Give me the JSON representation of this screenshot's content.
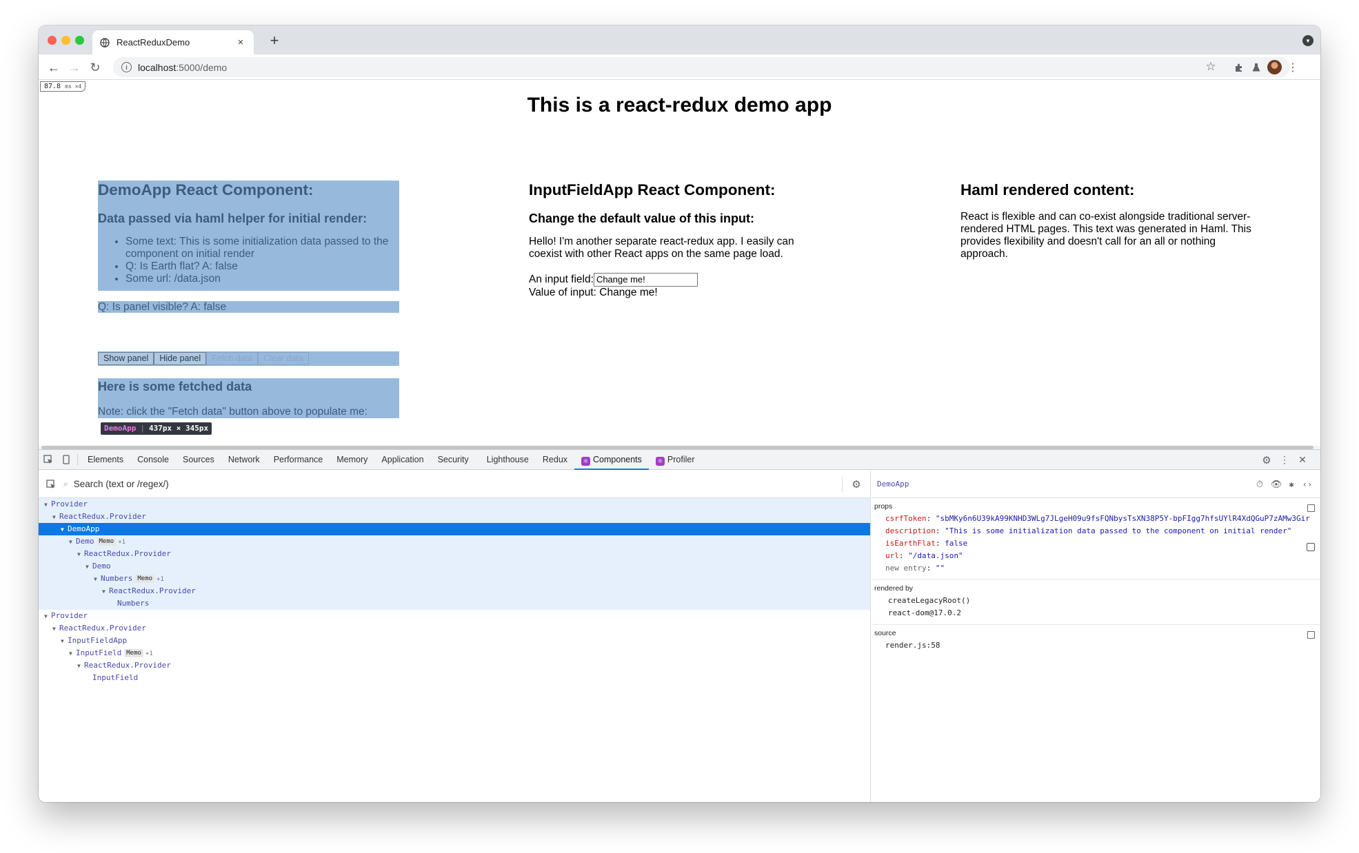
{
  "browser": {
    "tab_title": "ReactReduxDemo",
    "tab_close": "×",
    "new_tab": "+",
    "url_host": "localhost",
    "url_path": ":5000/demo"
  },
  "page": {
    "perf_value": "87.8",
    "perf_unit": "ms ×4",
    "title": "This is a react-redux demo app",
    "demo": {
      "heading": "DemoApp React Component:",
      "subheading": "Data passed via haml helper for initial render:",
      "items": [
        "Some text: This is some initialization data passed to the component on initial render",
        "Q: Is Earth flat? A: false",
        "Some url: /data.json"
      ],
      "panel_text": "Q: Is panel visible? A: false",
      "buttons": {
        "show": "Show panel",
        "hide": "Hide panel",
        "fetch": "Fetch data",
        "clear": "Clear data"
      },
      "fetched_heading": "Here is some fetched data",
      "fetched_note": "Note: click the \"Fetch data\" button above to populate me:",
      "badge_name": "DemoApp",
      "badge_size": "437px × 345px"
    },
    "input_app": {
      "heading": "InputFieldApp React Component:",
      "subheading": "Change the default value of this input:",
      "para": "Hello! I'm another separate react-redux app. I easily can coexist with other React apps on the same page load.",
      "field_label": "An input field:",
      "field_value": "Change me!",
      "value_label": "Value of input: Change me!"
    },
    "haml": {
      "heading": "Haml rendered content:",
      "para": "React is flexible and can co-exist alongside traditional server-rendered HTML pages. This text was generated in Haml. This provides flexibility and doesn't call for an all or nothing approach."
    }
  },
  "devtools": {
    "tabs": [
      "Elements",
      "Console",
      "Sources",
      "Network",
      "Performance",
      "Memory",
      "Application",
      "Security",
      "Lighthouse",
      "Redux",
      "Components",
      "Profiler"
    ],
    "active_tab": "Components",
    "search_placeholder": "Search (text or /regex/)",
    "tree": [
      {
        "label": "Provider",
        "depth": 0,
        "caret": true,
        "style": "blue"
      },
      {
        "label": "ReactRedux.Provider",
        "depth": 1,
        "caret": true,
        "style": "blue"
      },
      {
        "label": "DemoApp",
        "depth": 2,
        "caret": true,
        "style": "sel"
      },
      {
        "label": "Demo",
        "depth": 3,
        "caret": true,
        "memo": "Memo",
        "plus": "+1",
        "style": "blue"
      },
      {
        "label": "ReactRedux.Provider",
        "depth": 4,
        "caret": true,
        "style": "blue"
      },
      {
        "label": "Demo",
        "depth": 5,
        "caret": true,
        "style": "blue"
      },
      {
        "label": "Numbers",
        "depth": 6,
        "caret": true,
        "memo": "Memo",
        "plus": "+1",
        "style": "blue"
      },
      {
        "label": "ReactRedux.Provider",
        "depth": 7,
        "caret": true,
        "style": "blue"
      },
      {
        "label": "Numbers",
        "depth": 8,
        "caret": false,
        "style": "blue"
      },
      {
        "label": "Provider",
        "depth": 0,
        "caret": true,
        "style": ""
      },
      {
        "label": "ReactRedux.Provider",
        "depth": 1,
        "caret": true,
        "style": ""
      },
      {
        "label": "InputFieldApp",
        "depth": 2,
        "caret": true,
        "style": ""
      },
      {
        "label": "InputField",
        "depth": 3,
        "caret": true,
        "memo": "Memo",
        "plus": "+1",
        "style": ""
      },
      {
        "label": "ReactRedux.Provider",
        "depth": 4,
        "caret": true,
        "style": ""
      },
      {
        "label": "InputField",
        "depth": 5,
        "caret": false,
        "style": ""
      }
    ],
    "inspector": {
      "component": "DemoApp",
      "props_label": "props",
      "props": [
        {
          "key": "csrfToken",
          "value": "\"sbMKy6n6U39kA99KNHD3WLg7JLgeH09u9fsFQNbysTsXN38P5Y-bpFIgg7hfsUYlR4XdQGuP7zAMw3Gir"
        },
        {
          "key": "description",
          "value": "\"This is some initialization data passed to the component on initial render\""
        },
        {
          "key": "isEarthFlat",
          "value": "false"
        },
        {
          "key": "url",
          "value": "\"/data.json\""
        },
        {
          "key": "new entry",
          "value": "\"\""
        }
      ],
      "rendered_by_label": "rendered by",
      "rendered_by": [
        "createLegacyRoot()",
        "react-dom@17.0.2"
      ],
      "source_label": "source",
      "source": "render.js:58"
    }
  }
}
